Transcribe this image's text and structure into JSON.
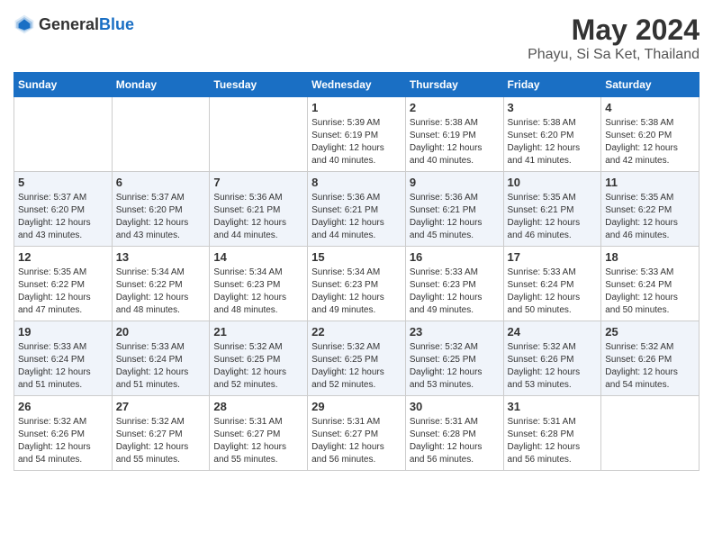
{
  "header": {
    "logo_general": "General",
    "logo_blue": "Blue",
    "title": "May 2024",
    "subtitle": "Phayu, Si Sa Ket, Thailand"
  },
  "weekdays": [
    "Sunday",
    "Monday",
    "Tuesday",
    "Wednesday",
    "Thursday",
    "Friday",
    "Saturday"
  ],
  "weeks": [
    {
      "days": [
        {
          "num": "",
          "info": ""
        },
        {
          "num": "",
          "info": ""
        },
        {
          "num": "",
          "info": ""
        },
        {
          "num": "1",
          "info": "Sunrise: 5:39 AM\nSunset: 6:19 PM\nDaylight: 12 hours\nand 40 minutes."
        },
        {
          "num": "2",
          "info": "Sunrise: 5:38 AM\nSunset: 6:19 PM\nDaylight: 12 hours\nand 40 minutes."
        },
        {
          "num": "3",
          "info": "Sunrise: 5:38 AM\nSunset: 6:20 PM\nDaylight: 12 hours\nand 41 minutes."
        },
        {
          "num": "4",
          "info": "Sunrise: 5:38 AM\nSunset: 6:20 PM\nDaylight: 12 hours\nand 42 minutes."
        }
      ]
    },
    {
      "days": [
        {
          "num": "5",
          "info": "Sunrise: 5:37 AM\nSunset: 6:20 PM\nDaylight: 12 hours\nand 43 minutes."
        },
        {
          "num": "6",
          "info": "Sunrise: 5:37 AM\nSunset: 6:20 PM\nDaylight: 12 hours\nand 43 minutes."
        },
        {
          "num": "7",
          "info": "Sunrise: 5:36 AM\nSunset: 6:21 PM\nDaylight: 12 hours\nand 44 minutes."
        },
        {
          "num": "8",
          "info": "Sunrise: 5:36 AM\nSunset: 6:21 PM\nDaylight: 12 hours\nand 44 minutes."
        },
        {
          "num": "9",
          "info": "Sunrise: 5:36 AM\nSunset: 6:21 PM\nDaylight: 12 hours\nand 45 minutes."
        },
        {
          "num": "10",
          "info": "Sunrise: 5:35 AM\nSunset: 6:21 PM\nDaylight: 12 hours\nand 46 minutes."
        },
        {
          "num": "11",
          "info": "Sunrise: 5:35 AM\nSunset: 6:22 PM\nDaylight: 12 hours\nand 46 minutes."
        }
      ]
    },
    {
      "days": [
        {
          "num": "12",
          "info": "Sunrise: 5:35 AM\nSunset: 6:22 PM\nDaylight: 12 hours\nand 47 minutes."
        },
        {
          "num": "13",
          "info": "Sunrise: 5:34 AM\nSunset: 6:22 PM\nDaylight: 12 hours\nand 48 minutes."
        },
        {
          "num": "14",
          "info": "Sunrise: 5:34 AM\nSunset: 6:23 PM\nDaylight: 12 hours\nand 48 minutes."
        },
        {
          "num": "15",
          "info": "Sunrise: 5:34 AM\nSunset: 6:23 PM\nDaylight: 12 hours\nand 49 minutes."
        },
        {
          "num": "16",
          "info": "Sunrise: 5:33 AM\nSunset: 6:23 PM\nDaylight: 12 hours\nand 49 minutes."
        },
        {
          "num": "17",
          "info": "Sunrise: 5:33 AM\nSunset: 6:24 PM\nDaylight: 12 hours\nand 50 minutes."
        },
        {
          "num": "18",
          "info": "Sunrise: 5:33 AM\nSunset: 6:24 PM\nDaylight: 12 hours\nand 50 minutes."
        }
      ]
    },
    {
      "days": [
        {
          "num": "19",
          "info": "Sunrise: 5:33 AM\nSunset: 6:24 PM\nDaylight: 12 hours\nand 51 minutes."
        },
        {
          "num": "20",
          "info": "Sunrise: 5:33 AM\nSunset: 6:24 PM\nDaylight: 12 hours\nand 51 minutes."
        },
        {
          "num": "21",
          "info": "Sunrise: 5:32 AM\nSunset: 6:25 PM\nDaylight: 12 hours\nand 52 minutes."
        },
        {
          "num": "22",
          "info": "Sunrise: 5:32 AM\nSunset: 6:25 PM\nDaylight: 12 hours\nand 52 minutes."
        },
        {
          "num": "23",
          "info": "Sunrise: 5:32 AM\nSunset: 6:25 PM\nDaylight: 12 hours\nand 53 minutes."
        },
        {
          "num": "24",
          "info": "Sunrise: 5:32 AM\nSunset: 6:26 PM\nDaylight: 12 hours\nand 53 minutes."
        },
        {
          "num": "25",
          "info": "Sunrise: 5:32 AM\nSunset: 6:26 PM\nDaylight: 12 hours\nand 54 minutes."
        }
      ]
    },
    {
      "days": [
        {
          "num": "26",
          "info": "Sunrise: 5:32 AM\nSunset: 6:26 PM\nDaylight: 12 hours\nand 54 minutes."
        },
        {
          "num": "27",
          "info": "Sunrise: 5:32 AM\nSunset: 6:27 PM\nDaylight: 12 hours\nand 55 minutes."
        },
        {
          "num": "28",
          "info": "Sunrise: 5:31 AM\nSunset: 6:27 PM\nDaylight: 12 hours\nand 55 minutes."
        },
        {
          "num": "29",
          "info": "Sunrise: 5:31 AM\nSunset: 6:27 PM\nDaylight: 12 hours\nand 56 minutes."
        },
        {
          "num": "30",
          "info": "Sunrise: 5:31 AM\nSunset: 6:28 PM\nDaylight: 12 hours\nand 56 minutes."
        },
        {
          "num": "31",
          "info": "Sunrise: 5:31 AM\nSunset: 6:28 PM\nDaylight: 12 hours\nand 56 minutes."
        },
        {
          "num": "",
          "info": ""
        }
      ]
    }
  ]
}
